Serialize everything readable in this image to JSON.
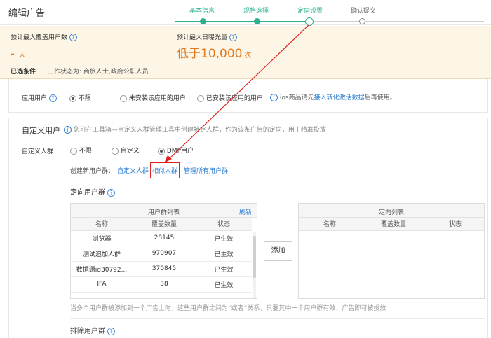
{
  "header": {
    "title": "编辑广告",
    "steps": [
      {
        "label": "基本信息",
        "state": "done"
      },
      {
        "label": "规格选择",
        "state": "done"
      },
      {
        "label": "定向设置",
        "state": "active"
      },
      {
        "label": "确认提交",
        "state": "todo"
      }
    ],
    "accent_color": "#2bb08d"
  },
  "estimate": {
    "coverage_label": "预计最大覆盖用户数",
    "coverage_value": "-",
    "coverage_unit": "人",
    "exposure_label": "预计最大日曝光量",
    "exposure_value": "低于10,000",
    "exposure_unit": "次",
    "selected_label": "已选条件",
    "selected_value": "工作状态为: 商旅人士,政府公职人员",
    "help_glyph": "?"
  },
  "app_users": {
    "label": "应用用户",
    "options": [
      "不限",
      "未安装该应用的用户",
      "已安装该应用的用户"
    ],
    "selected": "不限",
    "note_prefix": "ios商品请先",
    "note_link": "接入转化激活数据",
    "note_suffix": "后再使用。"
  },
  "custom_section": {
    "title": "自定义用户",
    "description": "您可在工具箱—自定义人群管理工具中创建特定人群，作为该条广告的定向，用于精准投放",
    "row_label": "自定义人群",
    "options": [
      "不限",
      "自定义",
      "DMP用户"
    ],
    "selected": "DMP用户",
    "create_label": "创建新用户群：",
    "create_links": [
      "自定义人群",
      "相似人群",
      "管理所有用户群"
    ],
    "highlight_color": "#e02020"
  },
  "targeting": {
    "title": "定向用户群",
    "list_title": "用户群列表",
    "refresh_label": "刷新",
    "columns": [
      "名称",
      "覆盖数量",
      "状态"
    ],
    "rows": [
      [
        "浏览器",
        "28145",
        "已生效"
      ],
      [
        "测试追加人群",
        "970907",
        "已生效"
      ],
      [
        "数据源id30792...",
        "370845",
        "已生效"
      ],
      [
        "IFA",
        "38",
        "已生效"
      ]
    ],
    "add_label": "添加",
    "target_title": "定向列表",
    "target_columns": [
      "名称",
      "覆盖数量",
      "状态"
    ],
    "footnote": "当多个用户群被添加到一个广告上时，这些用户群之间为“或者”关系，只要其中一个用户群有效，广告即可被投放"
  },
  "exclude": {
    "title": "排除用户群"
  }
}
